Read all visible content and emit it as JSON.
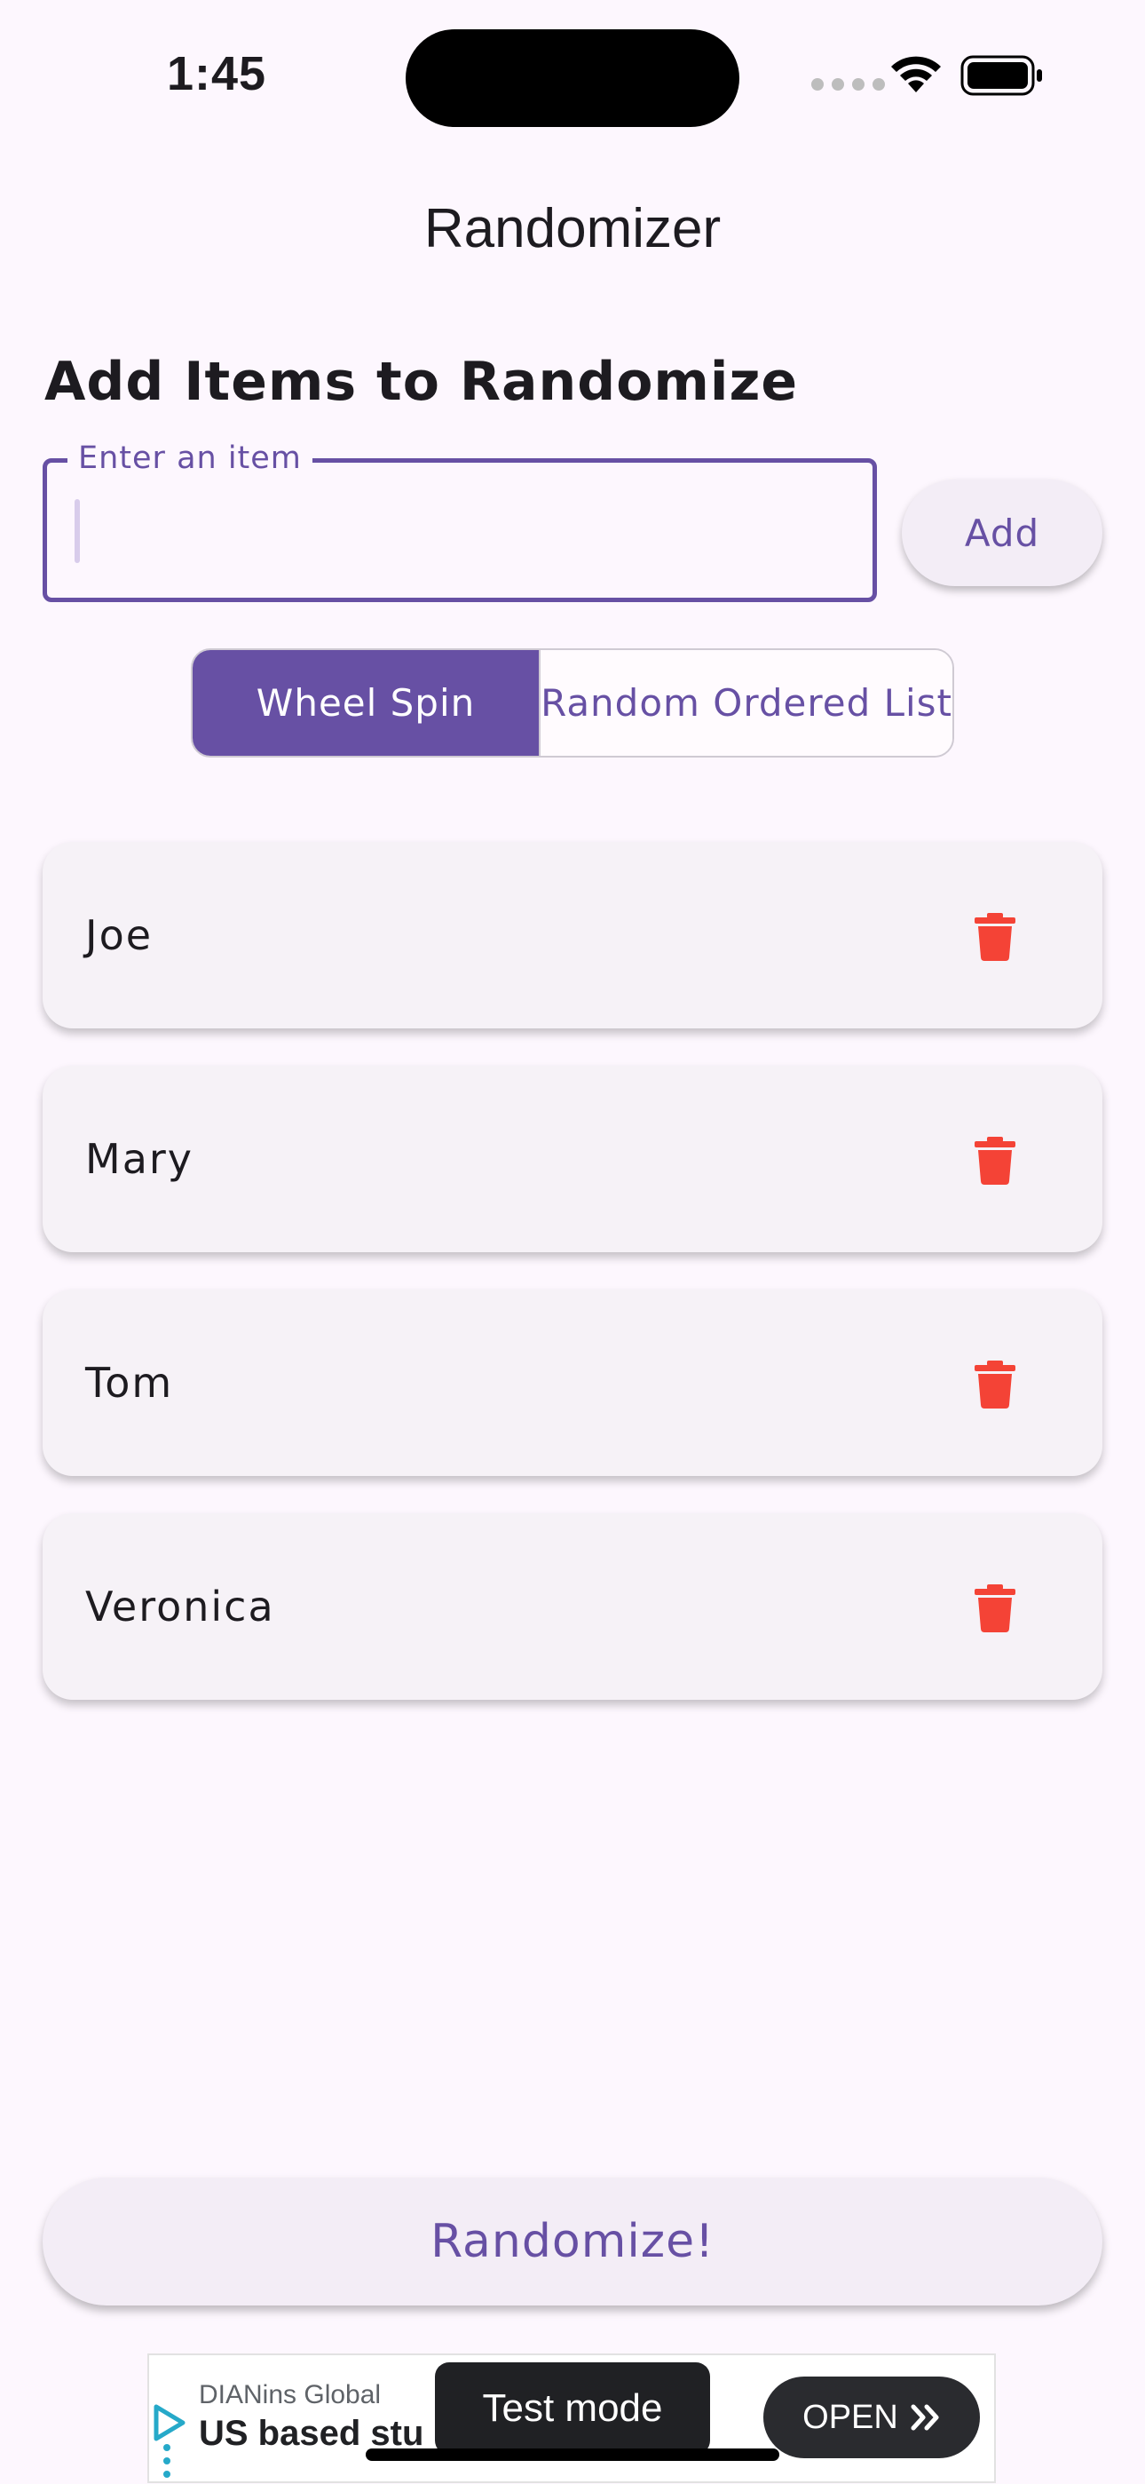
{
  "status_bar": {
    "time": "1:45"
  },
  "app": {
    "title": "Randomizer"
  },
  "form": {
    "heading": "Add Items to Randomize",
    "input_label": "Enter an item",
    "input_value": "",
    "add_label": "Add"
  },
  "modes": {
    "options": [
      "Wheel Spin",
      "Random Ordered List"
    ],
    "selected": "Wheel Spin"
  },
  "items": [
    "Joe",
    "Mary",
    "Tom",
    "Veronica"
  ],
  "randomize_label": "Randomize!",
  "ad": {
    "advertiser": "DIANins Global",
    "headline": "US based stu",
    "cta": "OPEN",
    "test_mode": "Test mode"
  },
  "colors": {
    "accent": "#6750A4",
    "background": "#FDF7FE",
    "delete": "#F44336",
    "card": "#F6F2F7"
  }
}
